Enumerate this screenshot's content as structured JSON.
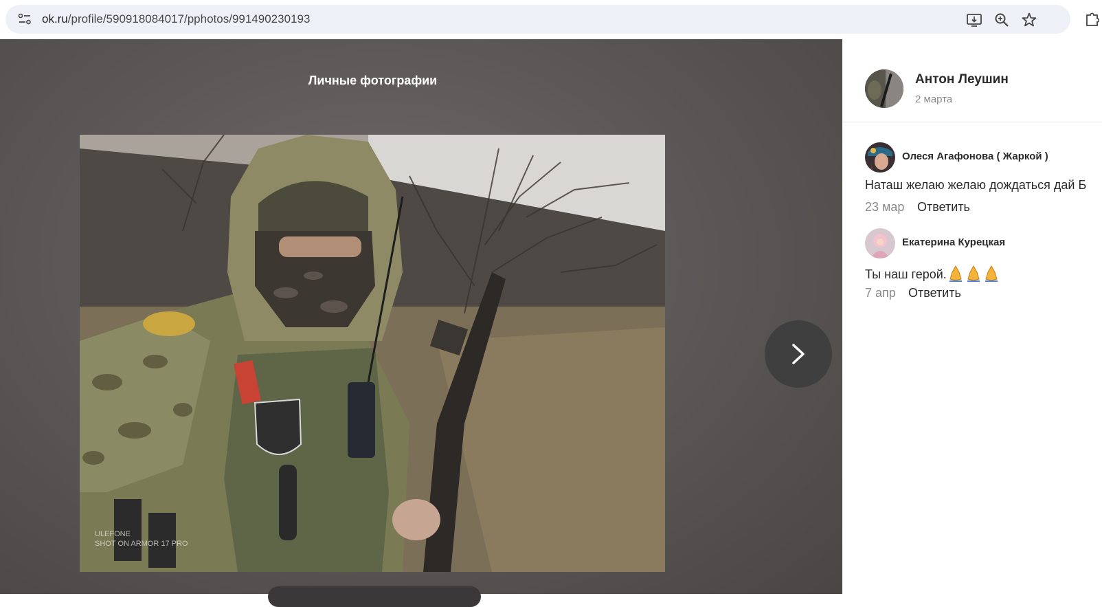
{
  "browser": {
    "url_host": "ok.ru",
    "url_path": "/profile/590918084017/pphotos/991490230193",
    "icons": [
      "site-info-icon",
      "install-app-icon",
      "zoom-icon",
      "bookmark-star-icon",
      "extensions-icon"
    ]
  },
  "viewer": {
    "album_title": "Личные фотографии",
    "watermark_line1": "ULEFONE",
    "watermark_line2": "SHOT ON ARMOR 17 PRO",
    "next_icon": "chevron-right-icon"
  },
  "post": {
    "author_name": "Антон Леушин",
    "date": "2 марта"
  },
  "comments": [
    {
      "author": "Олеся Агафонова ( Жаркой )",
      "text": "Наташ желаю желаю дождаться дай Б",
      "date": "23 мар",
      "reply_label": "Ответить"
    },
    {
      "author": "Екатерина Курецкая",
      "text": "Ты наш герой.",
      "emoji": "folded-hands-icon",
      "date": "7 апр",
      "reply_label": "Ответить"
    }
  ],
  "colors": {
    "viewer_bg": "#5d5958",
    "omnibox_bg": "#edf1f7",
    "text_primary": "#2b2b2b",
    "text_secondary": "#8a8a8a"
  }
}
